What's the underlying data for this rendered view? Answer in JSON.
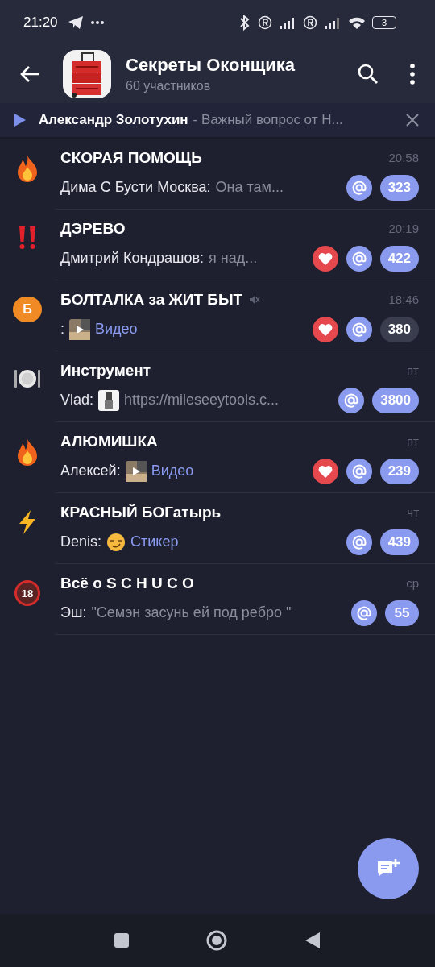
{
  "status_bar": {
    "time": "21:20",
    "battery": "3"
  },
  "header": {
    "title": "Секреты Оконщика",
    "subtitle": "60 участников"
  },
  "pinned": {
    "author": "Александр Золотухин",
    "text": "- Важный вопрос от Н..."
  },
  "topics": [
    {
      "kind": "fire",
      "title": "СКОРАЯ ПОМОЩЬ",
      "time": "20:58",
      "muted": false,
      "sender": "Дима С Бусти Москва:",
      "preview": {
        "kind": "text",
        "text": "Она там..."
      },
      "reaction": false,
      "mention": true,
      "unread": "323"
    },
    {
      "kind": "exclamation",
      "title": "ДЭРЕВО",
      "time": "20:19",
      "muted": false,
      "sender": "Дмитрий Кондрашов:",
      "preview": {
        "kind": "text",
        "text": "я над..."
      },
      "reaction": true,
      "mention": true,
      "unread": "422"
    },
    {
      "kind": "bubble",
      "icon_label": "Б",
      "title": "БОЛТАЛКА за ЖИТ БЫТ",
      "time": "18:46",
      "muted": true,
      "sender": ":",
      "thumb": {
        "kind": "video"
      },
      "preview": {
        "kind": "media",
        "text": "Видео"
      },
      "reaction": true,
      "mention": true,
      "unread": "380"
    },
    {
      "kind": "plate",
      "title": "Инструмент",
      "time": "пт",
      "muted": false,
      "sender": "Vlad:",
      "preview": {
        "kind": "text",
        "text": "https://mileseeytools.c..."
      },
      "reaction": false,
      "mention": true,
      "unread": "3800"
    },
    {
      "kind": "fire",
      "title": "АЛЮМИШКА",
      "time": "пт",
      "muted": false,
      "sender": "Алексей:",
      "thumb": {
        "kind": "video"
      },
      "preview": {
        "kind": "media",
        "text": "Видео"
      },
      "reaction": true,
      "mention": true,
      "unread": "239"
    },
    {
      "kind": "lightning",
      "title": "КРАСНЫЙ БОГатырь",
      "time": "чт",
      "muted": false,
      "sender": "Denis:",
      "thumb": {
        "kind": "sticker"
      },
      "preview": {
        "kind": "media",
        "text": "Стикер"
      },
      "reaction": false,
      "mention": true,
      "unread": "439"
    },
    {
      "kind": "no-entry",
      "icon_label": "18",
      "title": "Всё о S C H U C O",
      "time": "ср",
      "muted": false,
      "sender": "Эш:",
      "preview": {
        "kind": "text",
        "text": "\"Семэн засунь ей под ребро \""
      },
      "reaction": false,
      "mention": true,
      "unread": "55"
    }
  ]
}
